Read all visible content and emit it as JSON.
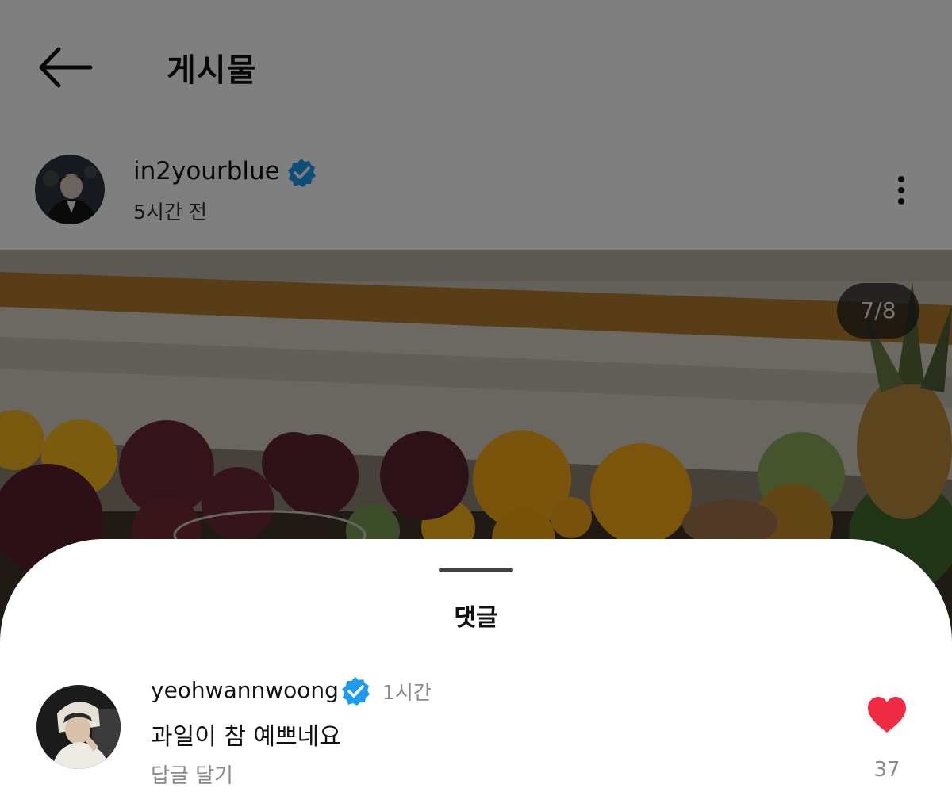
{
  "header": {
    "title": "게시물",
    "back_icon": "arrow-left-icon"
  },
  "post": {
    "author": "in2yourblue",
    "verified": true,
    "time": "5시간 전",
    "more_icon": "more-vertical-icon",
    "image_counter": "7/8"
  },
  "comments_sheet": {
    "title": "댓글",
    "comments": [
      {
        "author": "yeohwannwoong",
        "verified": true,
        "time": "1시간",
        "text": "과일이 참 예쁘네요",
        "reply_label": "답글 달기",
        "like_count": "37",
        "liked": true
      }
    ]
  },
  "colors": {
    "verified_badge": "#1D9BF0",
    "like_heart": "#EF2B44",
    "dim_overlay": "rgba(0,0,0,0.5)"
  }
}
